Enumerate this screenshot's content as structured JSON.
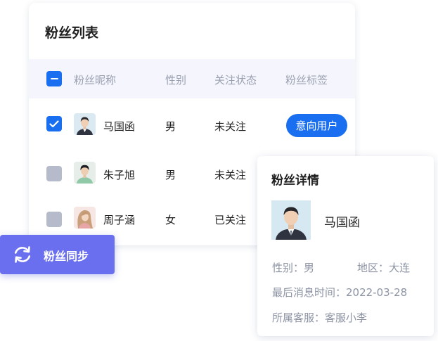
{
  "fan_list": {
    "title": "粉丝列表",
    "columns": [
      "粉丝昵称",
      "性别",
      "关注状态",
      "粉丝标签"
    ],
    "rows": [
      {
        "nickname": "马国函",
        "gender": "男",
        "status": "未关注",
        "tag": "意向用户",
        "checked": true
      },
      {
        "nickname": "朱子旭",
        "gender": "男",
        "status": "未关注",
        "tag": "",
        "checked": false
      },
      {
        "nickname": "周子涵",
        "gender": "女",
        "status": "已关注",
        "tag": "",
        "checked": false
      }
    ]
  },
  "sync_button": {
    "label": "粉丝同步",
    "icon": "sync-icon"
  },
  "fan_detail": {
    "title": "粉丝详情",
    "name": "马国函",
    "gender_text": "性别：男",
    "region_text": "地区：大连",
    "last_message_text": "最后消息时间：2022-03-28",
    "service_text": "所属客服：客服小李"
  },
  "colors": {
    "accent": "#1a6ef0",
    "sync": "#6a6ff0",
    "header_bg": "#f5f6fd",
    "unchecked": "#b5bbcb"
  }
}
